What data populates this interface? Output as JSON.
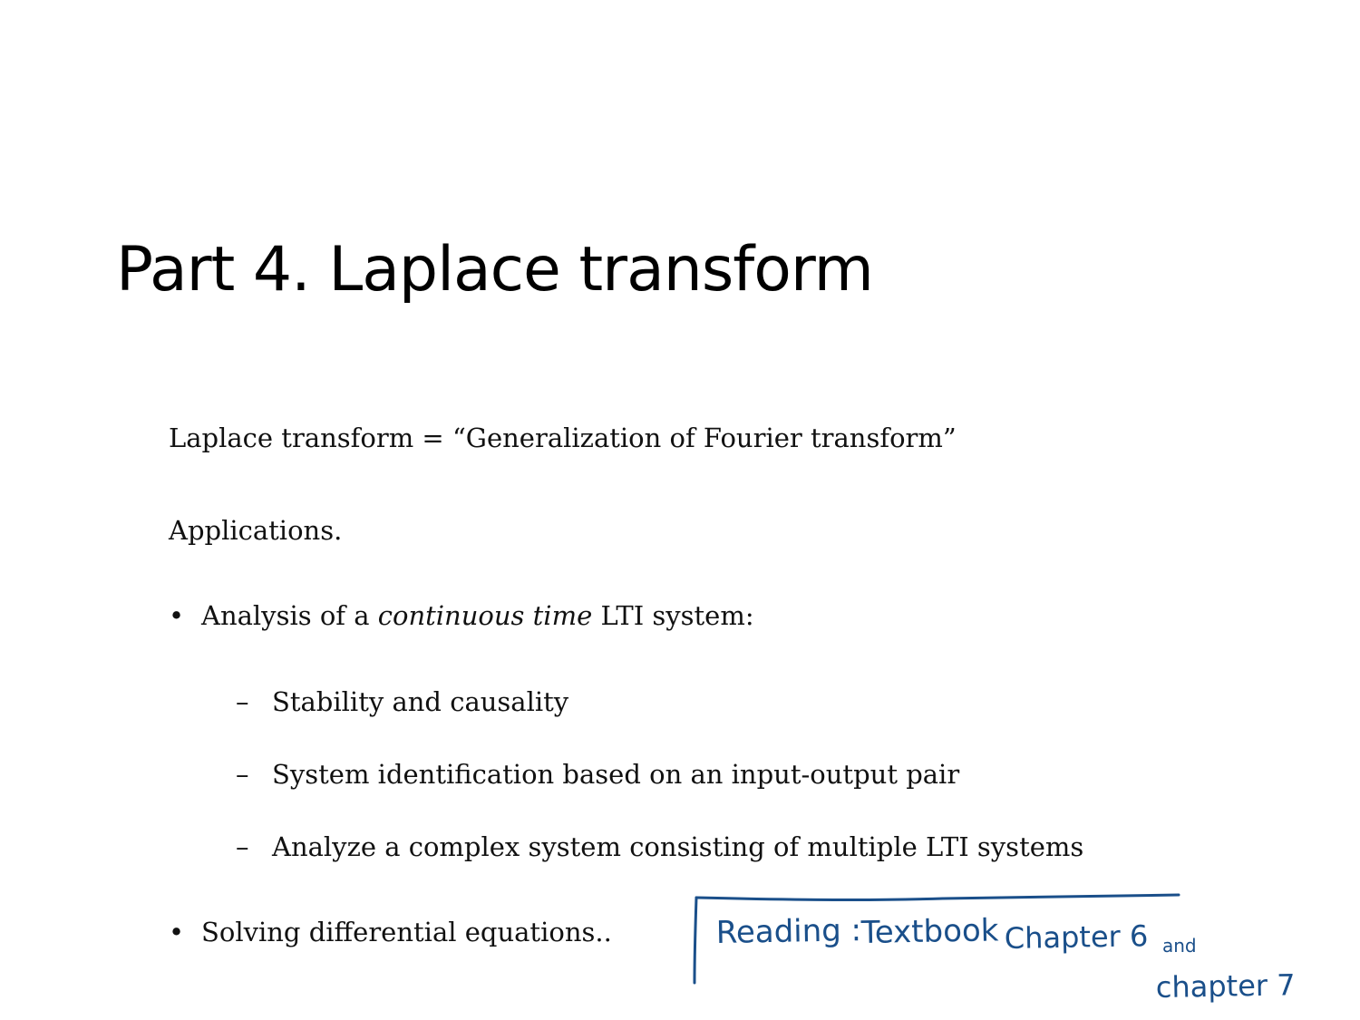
{
  "slide": {
    "title": "Part 4.  Laplace transform",
    "intro_left": "Laplace transform = ",
    "intro_quote": "“Generalization of Fourier transform”",
    "applications_heading": "Applications.",
    "bullets": [
      {
        "marker": "•",
        "text_before": "Analysis of a ",
        "text_italic": "continuous time",
        "text_after": " LTI system:"
      },
      {
        "marker": "•",
        "text": "Solving differential equations.."
      }
    ],
    "sub_items": [
      {
        "marker": "–",
        "text": "Stability and causality"
      },
      {
        "marker": "–",
        "text": "System identification based on an input-output pair"
      },
      {
        "marker": "–",
        "text": "Analyze a complex system consisting of multiple LTI systems"
      }
    ]
  },
  "handwritten_note": {
    "line1_reading": "Reading :",
    "line1_textbook": "Textbook",
    "line1_chapter": "Chapter 6",
    "line1_and": "and",
    "line2": "chapter 7",
    "ink_color": "#1a4f8a"
  }
}
